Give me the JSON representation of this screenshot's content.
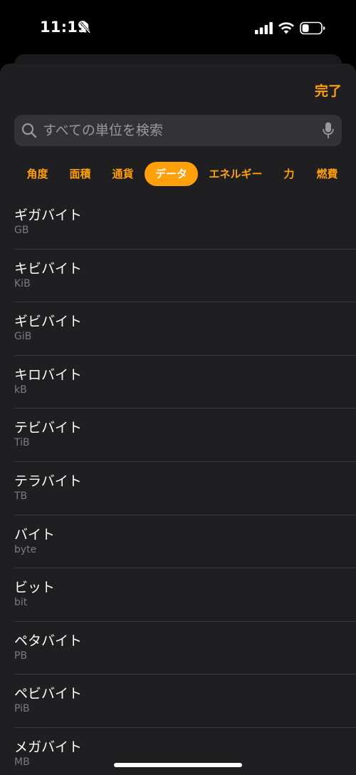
{
  "status_bar": {
    "time": "11:19",
    "icons": [
      "bell-slash-icon",
      "cellular-signal-icon",
      "wifi-icon",
      "battery-icon"
    ]
  },
  "header": {
    "done_label": "完了"
  },
  "search": {
    "placeholder": "すべての単位を検索",
    "value": ""
  },
  "tabs": [
    {
      "label": "角度",
      "active": false
    },
    {
      "label": "面積",
      "active": false
    },
    {
      "label": "通貨",
      "active": false
    },
    {
      "label": "データ",
      "active": true
    },
    {
      "label": "エネルギー",
      "active": false
    },
    {
      "label": "力",
      "active": false
    },
    {
      "label": "燃費",
      "active": false
    }
  ],
  "units": [
    {
      "name": "ギガバイト",
      "symbol": "GB"
    },
    {
      "name": "キビバイト",
      "symbol": "KiB"
    },
    {
      "name": "ギビバイト",
      "symbol": "GiB"
    },
    {
      "name": "キロバイト",
      "symbol": "kB"
    },
    {
      "name": "テビバイト",
      "symbol": "TiB"
    },
    {
      "name": "テラバイト",
      "symbol": "TB"
    },
    {
      "name": "バイト",
      "symbol": "byte"
    },
    {
      "name": "ビット",
      "symbol": "bit"
    },
    {
      "name": "ペタバイト",
      "symbol": "PB"
    },
    {
      "name": "ペビバイト",
      "symbol": "PiB"
    },
    {
      "name": "メガバイト",
      "symbol": "MB"
    }
  ],
  "colors": {
    "accent": "#ff9f0a",
    "sheet_background": "#1f1f21",
    "search_background": "#333336"
  }
}
